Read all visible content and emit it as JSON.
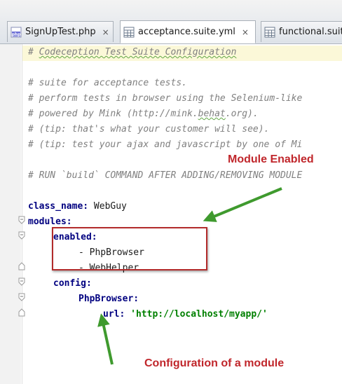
{
  "tabs": [
    {
      "label": "SignUpTest.php",
      "icon": "php-file-icon",
      "active": false
    },
    {
      "label": "acceptance.suite.yml",
      "icon": "yml-file-icon",
      "active": true
    },
    {
      "label": "functional.suit",
      "icon": "yml-file-icon",
      "active": false
    }
  ],
  "close_glyph": "×",
  "code": {
    "header_hash": "# ",
    "header_text": "Codeception Test Suite Configuration",
    "comments": [
      "# suite for acceptance tests.",
      "# perform tests in browser using the Selenium-like",
      "# (tip: that's what your customer will see).",
      "# (tip: test your ajax and javascript by one of Mi",
      "# RUN `build` COMMAND AFTER ADDING/REMOVING MODULE"
    ],
    "powered_a": "# powered by Mink (http://mink.",
    "powered_b": "behat",
    "powered_c": ".org).",
    "class_name_key": "class_name:",
    "class_name_val": " WebGuy",
    "modules_key": "modules:",
    "enabled_key": "enabled:",
    "enabled_items": [
      "- PhpBrowser",
      "- WebHelper"
    ],
    "config_key": "config:",
    "phpbrowser_key": "PhpBrowser:",
    "url_key": "url:",
    "url_val": "'http://localhost/myapp/'"
  },
  "annotations": {
    "module_enabled": "Module Enabled",
    "configuration": "Configuration of a module"
  },
  "colors": {
    "annotation_red": "#c0262b",
    "arrow_green": "#3f9a2e",
    "yaml_key": "#000080",
    "yaml_string": "#008000",
    "comment": "#808080"
  }
}
